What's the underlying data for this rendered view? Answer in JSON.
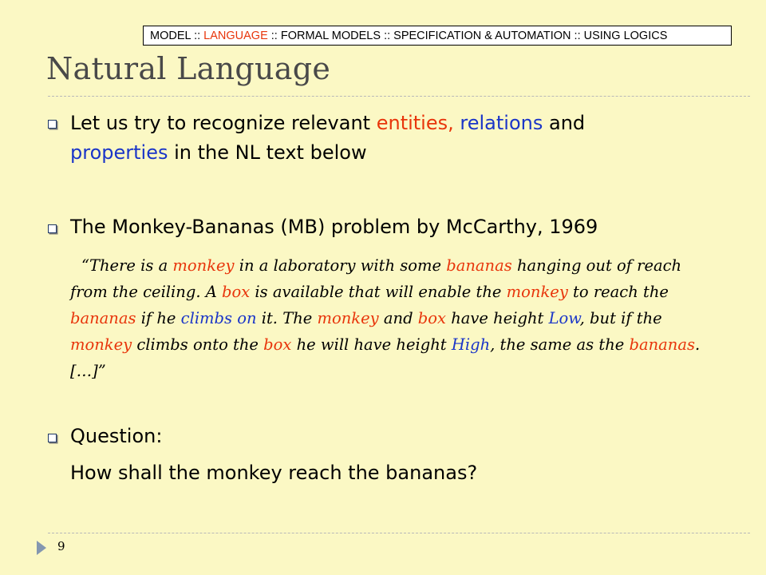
{
  "breadcrumb": {
    "items": [
      "MODEL",
      "LANGUAGE",
      "FORMAL MODELS",
      "SPECIFICATION & AUTOMATION",
      "USING LOGICS"
    ],
    "separator": "::",
    "active_color": "#E8350B"
  },
  "title": "Natural Language",
  "bullets": {
    "b1": {
      "part1": "Let us try to recognize relevant ",
      "entities": "entities,",
      "relations": "relations",
      "and": " and",
      "properties": "properties",
      "rest": " in the NL text below"
    },
    "b2": {
      "text": "The Monkey-Bananas (MB) problem by McCarthy, 1969"
    },
    "b3": {
      "label": "Question:",
      "question": "How shall the monkey reach the bananas?"
    }
  },
  "quote": {
    "l1": [
      "“There is a ",
      "monkey",
      " in a laboratory with some ",
      "bananas",
      " hanging out of reach"
    ],
    "l2": [
      "from the ceiling. A ",
      "box",
      " is available that will enable the ",
      "monkey",
      " to reach the"
    ],
    "l3": [
      "bananas",
      " if he ",
      "climbs on",
      " it. The ",
      "monkey",
      " and ",
      "box",
      " have height ",
      "Low",
      ", but if the"
    ],
    "l4": [
      "monkey",
      " climbs onto the ",
      "box",
      " he will have height ",
      "High",
      ", the same as the ",
      "bananas",
      "."
    ],
    "l5": [
      "[…]”"
    ]
  },
  "colors": {
    "entity": "#E8350B",
    "relation": "#1A35C8",
    "background": "#FBF8C4"
  },
  "footer": {
    "page_number": "9",
    "icon": "triangle-arrow-icon"
  }
}
